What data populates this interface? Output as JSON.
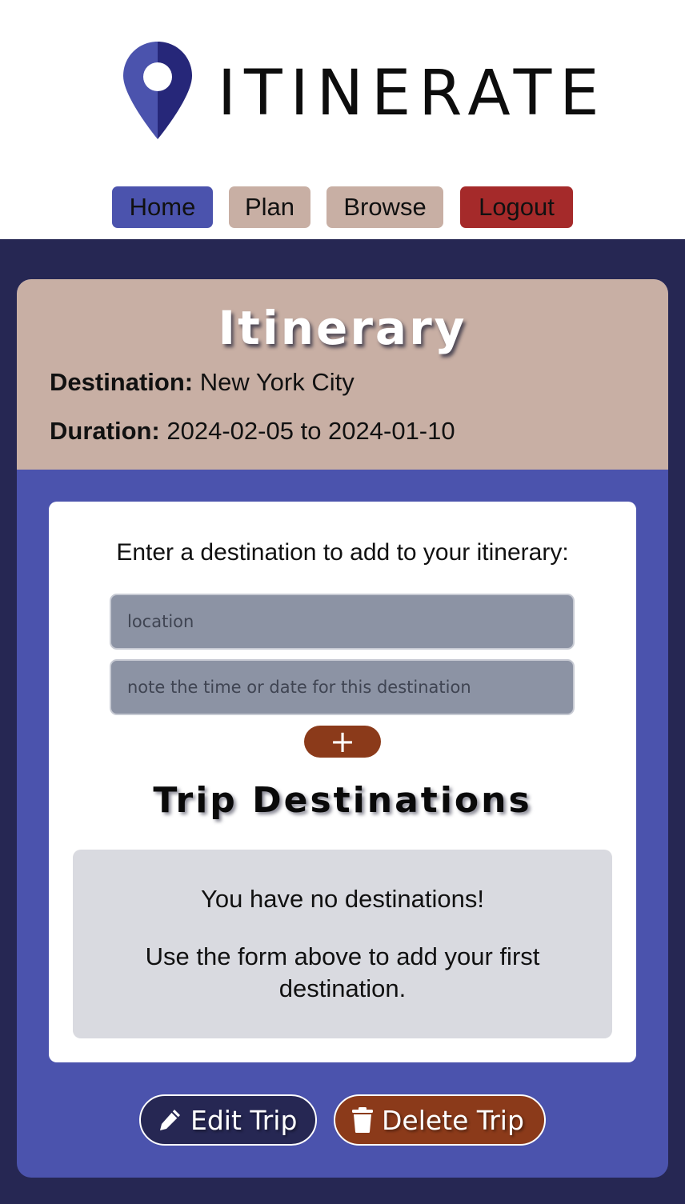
{
  "brand": {
    "name": "ITINERATE",
    "icon": "map-pin-icon"
  },
  "nav": {
    "home": "Home",
    "plan": "Plan",
    "browse": "Browse",
    "logout": "Logout"
  },
  "itinerary": {
    "title": "Itinerary",
    "destination_label": "Destination:",
    "destination_value": "New York City",
    "duration_label": "Duration:",
    "duration_value": "2024-02-05 to 2024-01-10"
  },
  "form": {
    "prompt": "Enter a destination to add to your itinerary:",
    "location_placeholder": "location",
    "note_placeholder": "note the time or date for this destination",
    "add_label": "+"
  },
  "trip": {
    "heading": "Trip Destinations",
    "empty_line1": "You have no destinations!",
    "empty_line2": "Use the form above to add your first destination."
  },
  "actions": {
    "edit_label": "Edit Trip",
    "edit_icon": "pencil-icon",
    "delete_label": "Delete Trip",
    "delete_icon": "trash-icon"
  },
  "colors": {
    "primary": "#4b53ad",
    "dark": "#262753",
    "tan": "#c8afa4",
    "danger": "#a52a2a",
    "rust": "#8b3a1a"
  }
}
